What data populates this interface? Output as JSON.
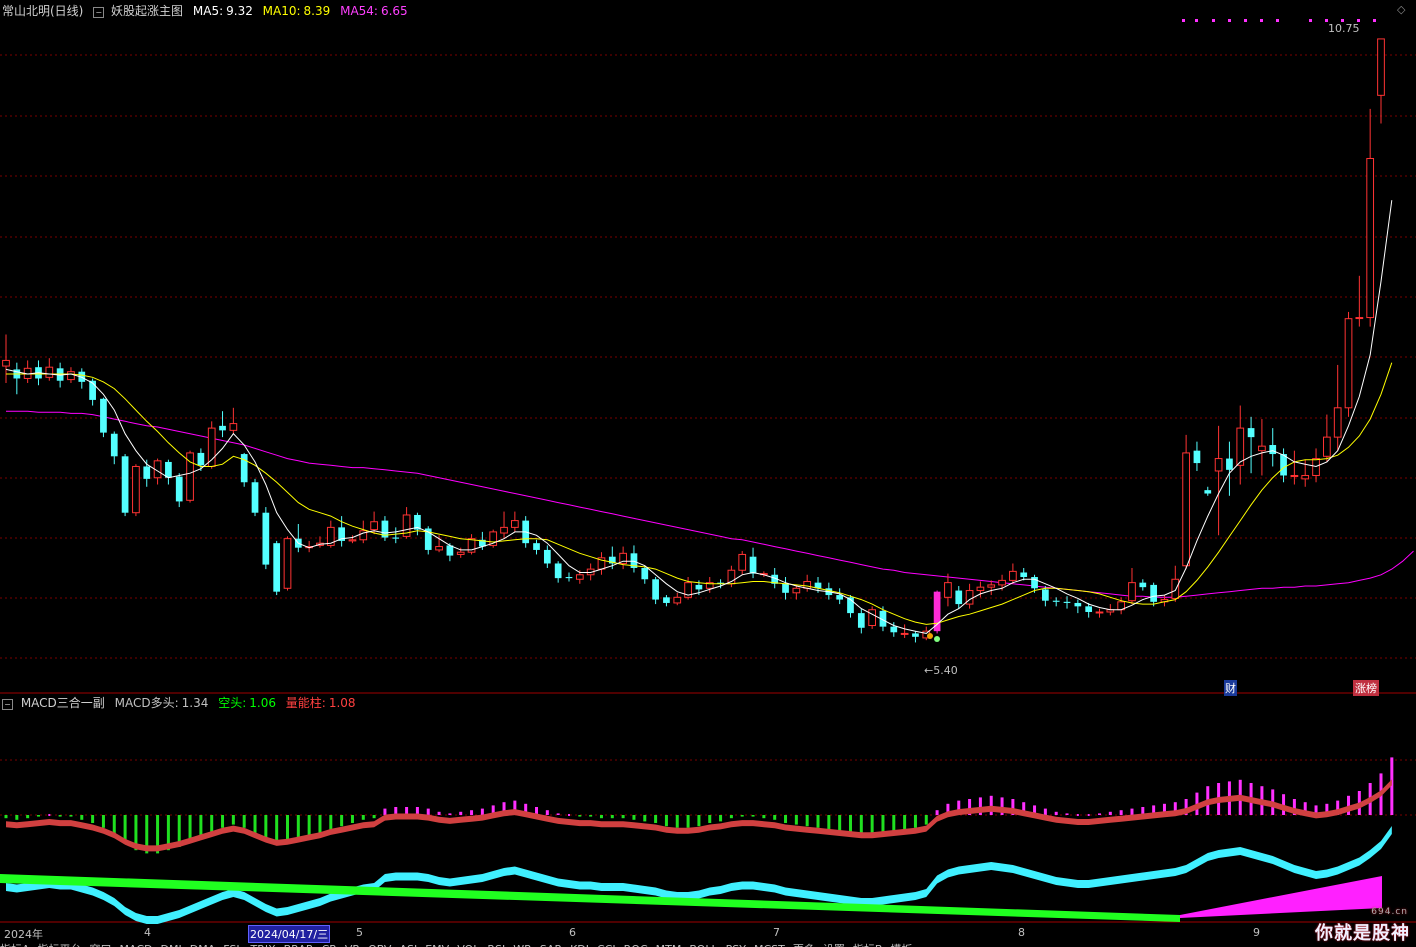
{
  "header": {
    "stock": "常山北明(日线)",
    "indicator": "妖股起涨主图",
    "ma5_label": "MA5:",
    "ma5": "9.32",
    "ma10_label": "MA10:",
    "ma10": "8.39",
    "ma54_label": "MA54:",
    "ma54": "6.65"
  },
  "sub_header": {
    "name": "MACD三合一副",
    "long_label": "MACD多头:",
    "long": "1.34",
    "short_label": "空头:",
    "short": "1.06",
    "vol_label": "量能柱:",
    "vol": "1.08"
  },
  "annotations": {
    "high": "10.75",
    "low": "5.40",
    "cai": "财",
    "zhangting": "涨榜"
  },
  "x_axis": {
    "year": "2024年",
    "m4": "4",
    "date": "2024/04/17/三",
    "m5": "5",
    "m6": "6",
    "m7": "7",
    "m8": "8",
    "m9": "9"
  },
  "bottom_tabs": [
    "指标A",
    "指标平台",
    "窗口",
    "MACD",
    "DMI",
    "DMA",
    "FSL",
    "TRIX",
    "BRAR",
    "CR",
    "VR",
    "OBV",
    "ASI",
    "EMV",
    "VOL",
    "RSI",
    "WR",
    "SAR",
    "KDJ",
    "CCI",
    "ROC",
    "MTM",
    "BOLL",
    "PSY",
    "MCST",
    "更多",
    "设置",
    "指标B",
    "模板"
  ],
  "watermark": {
    "text": "你就是股神",
    "sub": "694.cn"
  },
  "colors": {
    "up": "#ff3333",
    "down": "#54ffff",
    "ma5": "#ffffff",
    "ma10": "#ffff00",
    "ma54": "#ff00ff",
    "grid": "#7a0000"
  },
  "chart_data": {
    "type": "candlestick",
    "ylim": [
      5.2,
      10.9
    ],
    "candles": [
      [
        7.85,
        7.9,
        7.7,
        8.13
      ],
      [
        7.82,
        7.74,
        7.6,
        7.88
      ],
      [
        7.74,
        7.83,
        7.7,
        7.9
      ],
      [
        7.84,
        7.74,
        7.68,
        7.9
      ],
      [
        7.75,
        7.84,
        7.72,
        7.92
      ],
      [
        7.83,
        7.72,
        7.66,
        7.88
      ],
      [
        7.73,
        7.8,
        7.7,
        7.84
      ],
      [
        7.8,
        7.71,
        7.65,
        7.83
      ],
      [
        7.72,
        7.55,
        7.5,
        7.74
      ],
      [
        7.56,
        7.26,
        7.22,
        7.57
      ],
      [
        7.25,
        7.05,
        6.98,
        7.27
      ],
      [
        7.05,
        6.55,
        6.52,
        7.07
      ],
      [
        6.55,
        6.96,
        6.52,
        6.98
      ],
      [
        6.96,
        6.85,
        6.78,
        7.02
      ],
      [
        6.86,
        7.01,
        6.8,
        7.03
      ],
      [
        7.0,
        6.86,
        6.8,
        7.02
      ],
      [
        6.87,
        6.65,
        6.6,
        6.9
      ],
      [
        6.66,
        7.08,
        6.64,
        7.1
      ],
      [
        7.08,
        6.97,
        6.92,
        7.12
      ],
      [
        6.96,
        7.3,
        6.94,
        7.36
      ],
      [
        7.32,
        7.28,
        7.22,
        7.45
      ],
      [
        7.28,
        7.34,
        7.25,
        7.48
      ],
      [
        7.07,
        6.82,
        6.78,
        7.08
      ],
      [
        6.82,
        6.55,
        6.52,
        6.85
      ],
      [
        6.55,
        6.09,
        6.05,
        6.6
      ],
      [
        6.28,
        5.85,
        5.82,
        6.3
      ],
      [
        5.88,
        6.32,
        5.86,
        6.34
      ],
      [
        6.32,
        6.24,
        6.2,
        6.45
      ],
      [
        6.24,
        6.25,
        6.2,
        6.3
      ],
      [
        6.26,
        6.28,
        6.24,
        6.34
      ],
      [
        6.26,
        6.42,
        6.24,
        6.48
      ],
      [
        6.42,
        6.3,
        6.25,
        6.52
      ],
      [
        6.3,
        6.31,
        6.28,
        6.35
      ],
      [
        6.31,
        6.39,
        6.28,
        6.48
      ],
      [
        6.4,
        6.47,
        6.36,
        6.56
      ],
      [
        6.48,
        6.33,
        6.3,
        6.52
      ],
      [
        6.33,
        6.32,
        6.28,
        6.42
      ],
      [
        6.34,
        6.53,
        6.32,
        6.6
      ],
      [
        6.53,
        6.4,
        6.35,
        6.55
      ],
      [
        6.41,
        6.22,
        6.18,
        6.43
      ],
      [
        6.22,
        6.25,
        6.2,
        6.35
      ],
      [
        6.26,
        6.17,
        6.12,
        6.28
      ],
      [
        6.18,
        6.2,
        6.15,
        6.24
      ],
      [
        6.2,
        6.32,
        6.18,
        6.36
      ],
      [
        6.31,
        6.25,
        6.22,
        6.38
      ],
      [
        6.26,
        6.38,
        6.24,
        6.4
      ],
      [
        6.37,
        6.42,
        6.32,
        6.56
      ],
      [
        6.42,
        6.48,
        6.38,
        6.56
      ],
      [
        6.48,
        6.28,
        6.24,
        6.52
      ],
      [
        6.28,
        6.22,
        6.18,
        6.31
      ],
      [
        6.22,
        6.1,
        6.06,
        6.26
      ],
      [
        6.1,
        5.97,
        5.93,
        6.12
      ],
      [
        5.98,
        5.97,
        5.94,
        6.02
      ],
      [
        5.96,
        6.0,
        5.92,
        6.04
      ],
      [
        6.0,
        6.05,
        5.95,
        6.1
      ],
      [
        6.05,
        6.15,
        6.0,
        6.2
      ],
      [
        6.16,
        6.1,
        6.05,
        6.25
      ],
      [
        6.1,
        6.19,
        6.05,
        6.25
      ],
      [
        6.19,
        6.06,
        6.02,
        6.26
      ],
      [
        6.06,
        5.96,
        5.92,
        6.08
      ],
      [
        5.96,
        5.78,
        5.74,
        5.98
      ],
      [
        5.8,
        5.75,
        5.72,
        5.82
      ],
      [
        5.75,
        5.8,
        5.73,
        5.84
      ],
      [
        5.8,
        5.93,
        5.78,
        5.98
      ],
      [
        5.91,
        5.87,
        5.82,
        5.95
      ],
      [
        5.88,
        5.93,
        5.84,
        5.98
      ],
      [
        5.93,
        5.92,
        5.88,
        5.96
      ],
      [
        5.92,
        6.04,
        5.89,
        6.08
      ],
      [
        6.04,
        6.18,
        6.0,
        6.21
      ],
      [
        6.16,
        6.01,
        5.97,
        6.24
      ],
      [
        6.01,
        6.01,
        5.98,
        6.03
      ],
      [
        6.0,
        5.92,
        5.88,
        6.06
      ],
      [
        5.92,
        5.84,
        5.78,
        5.98
      ],
      [
        5.84,
        5.88,
        5.78,
        5.91
      ],
      [
        5.88,
        5.94,
        5.85,
        6.0
      ],
      [
        5.93,
        5.88,
        5.84,
        5.98
      ],
      [
        5.88,
        5.82,
        5.78,
        5.93
      ],
      [
        5.82,
        5.78,
        5.74,
        5.88
      ],
      [
        5.8,
        5.66,
        5.62,
        5.82
      ],
      [
        5.66,
        5.53,
        5.48,
        5.7
      ],
      [
        5.55,
        5.69,
        5.52,
        5.72
      ],
      [
        5.68,
        5.54,
        5.5,
        5.72
      ],
      [
        5.54,
        5.49,
        5.45,
        5.58
      ],
      [
        5.48,
        5.48,
        5.44,
        5.56
      ],
      [
        5.48,
        5.45,
        5.4,
        5.5
      ],
      [
        5.44,
        5.5,
        5.42,
        5.54
      ],
      [
        5.5,
        5.85,
        5.48,
        5.86
      ],
      [
        5.8,
        5.93,
        5.72,
        6.01
      ],
      [
        5.86,
        5.74,
        5.7,
        5.9
      ],
      [
        5.74,
        5.86,
        5.7,
        5.92
      ],
      [
        5.86,
        5.89,
        5.8,
        5.94
      ],
      [
        5.89,
        5.91,
        5.82,
        5.95
      ],
      [
        5.91,
        5.95,
        5.86,
        6.0
      ],
      [
        5.95,
        6.03,
        5.92,
        6.1
      ],
      [
        6.02,
        5.98,
        5.95,
        6.06
      ],
      [
        5.98,
        5.88,
        5.84,
        6.0
      ],
      [
        5.87,
        5.77,
        5.72,
        5.9
      ],
      [
        5.77,
        5.76,
        5.72,
        5.8
      ],
      [
        5.76,
        5.75,
        5.7,
        5.81
      ],
      [
        5.75,
        5.72,
        5.66,
        5.78
      ],
      [
        5.72,
        5.67,
        5.62,
        5.75
      ],
      [
        5.67,
        5.67,
        5.62,
        5.7
      ],
      [
        5.67,
        5.69,
        5.64,
        5.74
      ],
      [
        5.69,
        5.76,
        5.65,
        5.8
      ],
      [
        5.77,
        5.93,
        5.74,
        6.06
      ],
      [
        5.93,
        5.89,
        5.86,
        5.96
      ],
      [
        5.91,
        5.76,
        5.72,
        5.93
      ],
      [
        5.76,
        5.78,
        5.72,
        5.82
      ],
      [
        5.79,
        5.96,
        5.76,
        6.08
      ],
      [
        6.08,
        7.08,
        6.05,
        7.24
      ],
      [
        7.1,
        6.99,
        6.92,
        7.18
      ],
      [
        6.75,
        6.72,
        6.7,
        6.78
      ],
      [
        6.92,
        7.03,
        6.35,
        7.32
      ],
      [
        7.03,
        6.93,
        6.7,
        7.18
      ],
      [
        6.97,
        7.3,
        6.8,
        7.5
      ],
      [
        7.3,
        7.22,
        6.9,
        7.4
      ],
      [
        7.1,
        7.14,
        6.88,
        7.38
      ],
      [
        7.15,
        7.07,
        6.96,
        7.3
      ],
      [
        7.07,
        6.88,
        6.82,
        7.12
      ],
      [
        6.88,
        6.88,
        6.8,
        7.1
      ],
      [
        6.85,
        6.88,
        6.78,
        7.02
      ],
      [
        6.88,
        7.03,
        6.82,
        7.12
      ],
      [
        7.05,
        7.22,
        7.0,
        7.42
      ],
      [
        7.22,
        7.48,
        7.1,
        7.86
      ],
      [
        7.48,
        8.27,
        7.4,
        8.33
      ],
      [
        8.28,
        8.28,
        8.2,
        8.65
      ],
      [
        8.28,
        9.69,
        8.2,
        10.13
      ],
      [
        10.25,
        10.75,
        10.0,
        10.75
      ]
    ],
    "ma5": [
      7.82,
      7.8,
      7.78,
      7.79,
      7.78,
      7.77,
      7.78,
      7.75,
      7.7,
      7.6,
      7.46,
      7.25,
      7.1,
      6.98,
      6.92,
      6.86,
      6.88,
      6.9,
      6.94,
      7.02,
      7.12,
      7.25,
      7.15,
      7.0,
      6.8,
      6.55,
      6.4,
      6.28,
      6.24,
      6.27,
      6.28,
      6.32,
      6.33,
      6.37,
      6.39,
      6.37,
      6.38,
      6.4,
      6.42,
      6.38,
      6.32,
      6.26,
      6.22,
      6.22,
      6.25,
      6.28,
      6.32,
      6.38,
      6.38,
      6.35,
      6.28,
      6.18,
      6.08,
      6.02,
      6.02,
      6.05,
      6.08,
      6.12,
      6.12,
      6.08,
      6.0,
      5.92,
      5.85,
      5.82,
      5.84,
      5.87,
      5.9,
      5.94,
      6.0,
      6.02,
      6.0,
      5.97,
      5.93,
      5.9,
      5.88,
      5.86,
      5.85,
      5.83,
      5.78,
      5.7,
      5.65,
      5.6,
      5.55,
      5.52,
      5.5,
      5.48,
      5.56,
      5.65,
      5.7,
      5.78,
      5.83,
      5.86,
      5.88,
      5.93,
      5.96,
      5.96,
      5.92,
      5.88,
      5.83,
      5.79,
      5.74,
      5.71,
      5.69,
      5.69,
      5.73,
      5.78,
      5.81,
      5.82,
      5.86,
      6.06,
      6.3,
      6.52,
      6.72,
      6.9,
      7.0,
      7.05,
      7.08,
      7.1,
      7.06,
      7.0,
      6.98,
      6.96,
      7.0,
      7.1,
      7.32,
      7.58,
      7.95,
      8.6,
      9.32
    ],
    "ma10": [
      7.78,
      7.78,
      7.78,
      7.78,
      7.78,
      7.78,
      7.78,
      7.77,
      7.75,
      7.71,
      7.65,
      7.56,
      7.46,
      7.36,
      7.27,
      7.17,
      7.08,
      7.0,
      6.96,
      6.96,
      6.98,
      7.05,
      7.02,
      6.97,
      6.9,
      6.82,
      6.73,
      6.64,
      6.58,
      6.55,
      6.52,
      6.47,
      6.43,
      6.4,
      6.37,
      6.35,
      6.36,
      6.37,
      6.39,
      6.38,
      6.36,
      6.34,
      6.32,
      6.31,
      6.3,
      6.29,
      6.3,
      6.31,
      6.32,
      6.32,
      6.31,
      6.27,
      6.23,
      6.19,
      6.16,
      6.13,
      6.11,
      6.09,
      6.08,
      6.07,
      6.05,
      6.01,
      5.97,
      5.94,
      5.93,
      5.92,
      5.92,
      5.92,
      5.93,
      5.94,
      5.94,
      5.93,
      5.92,
      5.91,
      5.9,
      5.88,
      5.86,
      5.84,
      5.81,
      5.78,
      5.74,
      5.69,
      5.65,
      5.61,
      5.58,
      5.56,
      5.57,
      5.6,
      5.63,
      5.65,
      5.68,
      5.71,
      5.74,
      5.78,
      5.82,
      5.86,
      5.88,
      5.88,
      5.87,
      5.86,
      5.85,
      5.83,
      5.8,
      5.77,
      5.75,
      5.74,
      5.74,
      5.76,
      5.78,
      5.85,
      5.95,
      6.07,
      6.2,
      6.34,
      6.48,
      6.62,
      6.75,
      6.86,
      6.95,
      7.0,
      7.02,
      7.02,
      7.03,
      7.06,
      7.13,
      7.23,
      7.38,
      7.6,
      7.88
    ],
    "ma54": [
      7.45,
      7.45,
      7.45,
      7.44,
      7.44,
      7.44,
      7.43,
      7.43,
      7.42,
      7.4,
      7.38,
      7.36,
      7.34,
      7.32,
      7.31,
      7.29,
      7.27,
      7.25,
      7.23,
      7.21,
      7.19,
      7.17,
      7.15,
      7.12,
      7.09,
      7.06,
      7.03,
      7.01,
      6.99,
      6.98,
      6.97,
      6.96,
      6.95,
      6.95,
      6.94,
      6.93,
      6.92,
      6.91,
      6.9,
      6.88,
      6.86,
      6.84,
      6.82,
      6.8,
      6.78,
      6.76,
      6.74,
      6.72,
      6.7,
      6.68,
      6.66,
      6.64,
      6.62,
      6.6,
      6.58,
      6.56,
      6.54,
      6.52,
      6.5,
      6.48,
      6.46,
      6.44,
      6.42,
      6.4,
      6.38,
      6.36,
      6.34,
      6.32,
      6.31,
      6.29,
      6.27,
      6.25,
      6.23,
      6.21,
      6.19,
      6.17,
      6.15,
      6.13,
      6.11,
      6.09,
      6.07,
      6.05,
      6.04,
      6.02,
      6.01,
      6.0,
      5.99,
      5.98,
      5.97,
      5.96,
      5.95,
      5.94,
      5.93,
      5.92,
      5.91,
      5.9,
      5.89,
      5.88,
      5.87,
      5.86,
      5.85,
      5.84,
      5.83,
      5.82,
      5.81,
      5.81,
      5.8,
      5.8,
      5.8,
      5.81,
      5.82,
      5.83,
      5.84,
      5.85,
      5.86,
      5.87,
      5.88,
      5.88,
      5.89,
      5.89,
      5.9,
      5.9,
      5.91,
      5.92,
      5.93,
      5.95,
      5.97,
      6.0,
      6.05,
      6.12,
      6.21
    ],
    "macd_hist": [
      -0.02,
      -0.03,
      -0.02,
      -0.01,
      0.0,
      -0.01,
      -0.01,
      -0.03,
      -0.05,
      -0.08,
      -0.12,
      -0.18,
      -0.22,
      -0.24,
      -0.24,
      -0.22,
      -0.2,
      -0.17,
      -0.14,
      -0.11,
      -0.08,
      -0.06,
      -0.08,
      -0.12,
      -0.16,
      -0.19,
      -0.18,
      -0.16,
      -0.14,
      -0.12,
      -0.09,
      -0.07,
      -0.05,
      -0.03,
      -0.02,
      0.04,
      0.05,
      0.05,
      0.05,
      0.04,
      0.02,
      0.01,
      0.02,
      0.03,
      0.04,
      0.06,
      0.08,
      0.09,
      0.07,
      0.05,
      0.03,
      0.01,
      0.0,
      -0.01,
      -0.01,
      -0.02,
      -0.02,
      -0.02,
      -0.03,
      -0.04,
      -0.05,
      -0.07,
      -0.08,
      -0.08,
      -0.07,
      -0.05,
      -0.04,
      -0.02,
      -0.01,
      -0.01,
      -0.02,
      -0.03,
      -0.05,
      -0.06,
      -0.07,
      -0.08,
      -0.09,
      -0.1,
      -0.11,
      -0.12,
      -0.12,
      -0.11,
      -0.1,
      -0.09,
      -0.08,
      -0.06,
      0.03,
      0.07,
      0.09,
      0.1,
      0.11,
      0.12,
      0.11,
      0.1,
      0.08,
      0.06,
      0.04,
      0.02,
      0.01,
      0.0,
      0.0,
      0.01,
      0.02,
      0.03,
      0.04,
      0.05,
      0.06,
      0.07,
      0.08,
      0.1,
      0.14,
      0.18,
      0.2,
      0.21,
      0.22,
      0.2,
      0.18,
      0.16,
      0.13,
      0.1,
      0.08,
      0.06,
      0.07,
      0.09,
      0.12,
      0.15,
      0.2,
      0.26,
      0.36
    ],
    "sub_labels": [
      "MACD多头",
      "空头",
      "量能柱"
    ]
  }
}
